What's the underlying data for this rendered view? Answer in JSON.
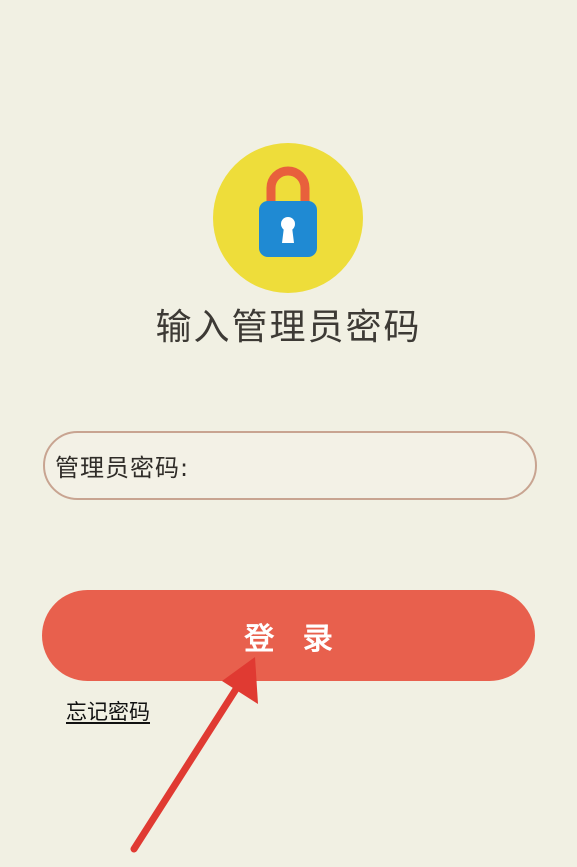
{
  "header": {
    "lock_icon": "padlock-icon",
    "title": "输入管理员密码"
  },
  "form": {
    "password_label": "管理员密码:",
    "password_value": "",
    "login_label": "登 录",
    "forgot_label": "忘记密码"
  },
  "annotation": {
    "arrow_icon": "red-arrow-icon",
    "arrow_color": "#e03a32"
  },
  "colors": {
    "background": "#f1f0e3",
    "badge": "#eedd3a",
    "lock_shackle": "#e8603c",
    "lock_body": "#1f8ad3",
    "button": "#e8604d",
    "field_border": "#c8a491"
  }
}
